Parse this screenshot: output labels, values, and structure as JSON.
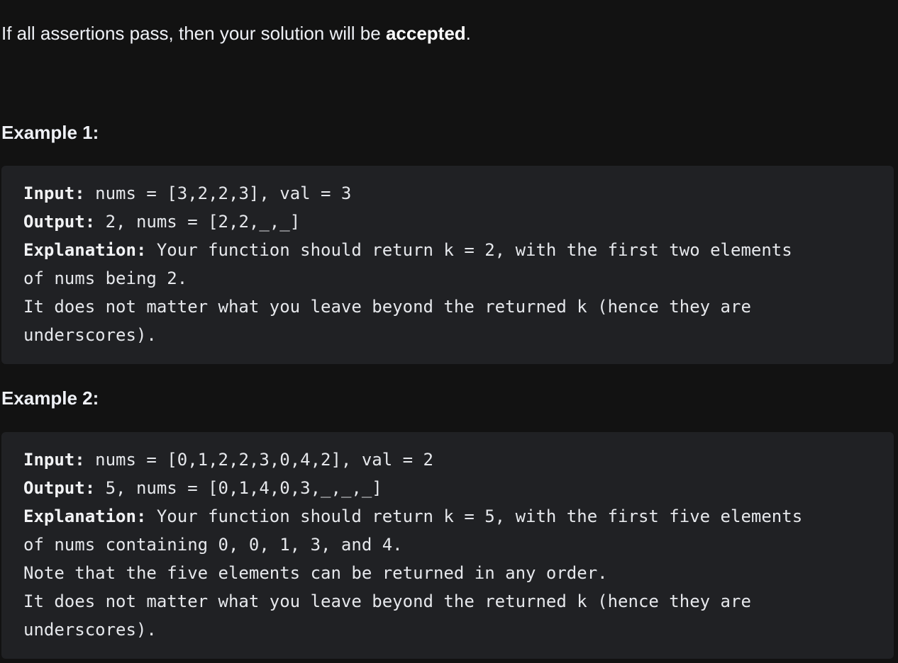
{
  "intro": {
    "prefix": "If all assertions pass, then your solution will be ",
    "bold": "accepted",
    "suffix": "."
  },
  "examples": [
    {
      "heading": "Example 1:",
      "input_label": "Input:",
      "input_value": " nums = [3,2,2,3], val = 3",
      "output_label": "Output:",
      "output_value": " 2, nums = [2,2,_,_]",
      "explanation_label": "Explanation:",
      "explanation_value": " Your function should return k = 2, with the first two elements",
      "lines": [
        "of nums being 2.",
        "It does not matter what you leave beyond the returned k (hence they are",
        "underscores)."
      ]
    },
    {
      "heading": "Example 2:",
      "input_label": "Input:",
      "input_value": " nums = [0,1,2,2,3,0,4,2], val = 2",
      "output_label": "Output:",
      "output_value": " 5, nums = [0,1,4,0,3,_,_,_]",
      "explanation_label": "Explanation:",
      "explanation_value": " Your function should return k = 5, with the first five elements",
      "lines": [
        "of nums containing 0, 0, 1, 3, and 4.",
        "Note that the five elements can be returned in any order.",
        "It does not matter what you leave beyond the returned k (hence they are",
        "underscores)."
      ]
    }
  ]
}
